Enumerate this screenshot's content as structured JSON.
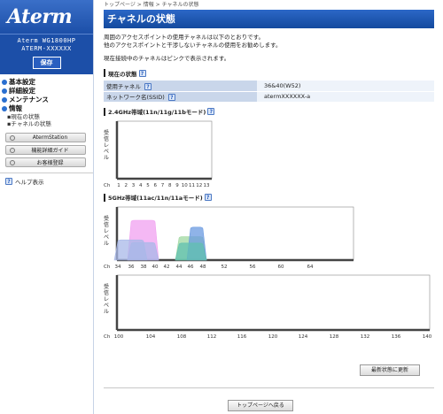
{
  "brand": {
    "logo": "Aterm",
    "model_line1": "Aterm WG1800HP",
    "model_line2": "ATERM-XXXXXX",
    "save_label": "保存"
  },
  "nav": {
    "items": [
      {
        "label": "基本設定"
      },
      {
        "label": "詳細設定"
      },
      {
        "label": "メンテナンス"
      },
      {
        "label": "情報"
      }
    ],
    "subitems": [
      {
        "label": "▪現在の状態"
      },
      {
        "label": "▪チャネルの状態"
      }
    ],
    "buttons": [
      {
        "label": "AtermStation"
      },
      {
        "label": "機能詳細ガイド"
      },
      {
        "label": "お客様登録"
      }
    ],
    "help_label": "ヘルプ表示"
  },
  "breadcrumb": "トップページ > 情報 > チャネルの状態",
  "page_title": "チャネルの状態",
  "intro": {
    "line1": "周囲のアクセスポイントの使用チャネルは以下のとおりです。",
    "line2": "他のアクセスポイントと干渉しないチャネルの使用をお勧めします。",
    "line3": "現在接続中のチャネルはピンクで表示されます。"
  },
  "current": {
    "heading": "現在の状態",
    "rows": [
      {
        "key": "使用チャネル",
        "value": "36&40(W52)"
      },
      {
        "key": "ネットワーク名(SSID)",
        "value": "atermXXXXXX-a"
      }
    ]
  },
  "band24": {
    "heading": "2.4GHz帯域(11n/11g/11bモード)",
    "ylabel": "受信レベル",
    "ch_label": "Ch"
  },
  "band5": {
    "heading": "5GHz帯域(11ac/11n/11aモード)",
    "ylabel": "受信レベル",
    "ch_label": "Ch"
  },
  "buttons": {
    "refresh": "最新状態に更新",
    "top": "トップページへ戻る"
  },
  "chart_data": [
    {
      "type": "area",
      "title": "2.4GHz帯域(11n/11g/11bモード)",
      "ylabel": "受信レベル",
      "x": [
        1,
        2,
        3,
        4,
        5,
        6,
        7,
        8,
        9,
        10,
        11,
        12,
        13
      ],
      "series": []
    },
    {
      "type": "area",
      "title": "5GHz帯域(11ac/11n/11aモード)",
      "ylabel": "受信レベル",
      "x": [
        34,
        36,
        38,
        40,
        42,
        44,
        46,
        48,
        52,
        56,
        60,
        64
      ],
      "series": [
        {
          "color": "#f0a0f0",
          "x_range": [
            36,
            40
          ],
          "level": 0.75
        },
        {
          "color": "#a8b8e8",
          "x_range": [
            34,
            38
          ],
          "level": 0.38
        },
        {
          "color": "#a8b8e8",
          "x_range": [
            36,
            40
          ],
          "level": 0.33
        },
        {
          "color": "#9fd8a0",
          "x_range": [
            44,
            48
          ],
          "level": 0.44
        },
        {
          "color": "#6a9ae0",
          "x_range": [
            46,
            48
          ],
          "level": 0.62
        },
        {
          "color": "#60c0b0",
          "x_range": [
            44,
            48
          ],
          "level": 0.32
        }
      ]
    },
    {
      "type": "area",
      "ylabel": "受信レベル",
      "x": [
        100,
        104,
        108,
        112,
        116,
        120,
        124,
        128,
        132,
        136,
        140
      ],
      "series": []
    }
  ]
}
